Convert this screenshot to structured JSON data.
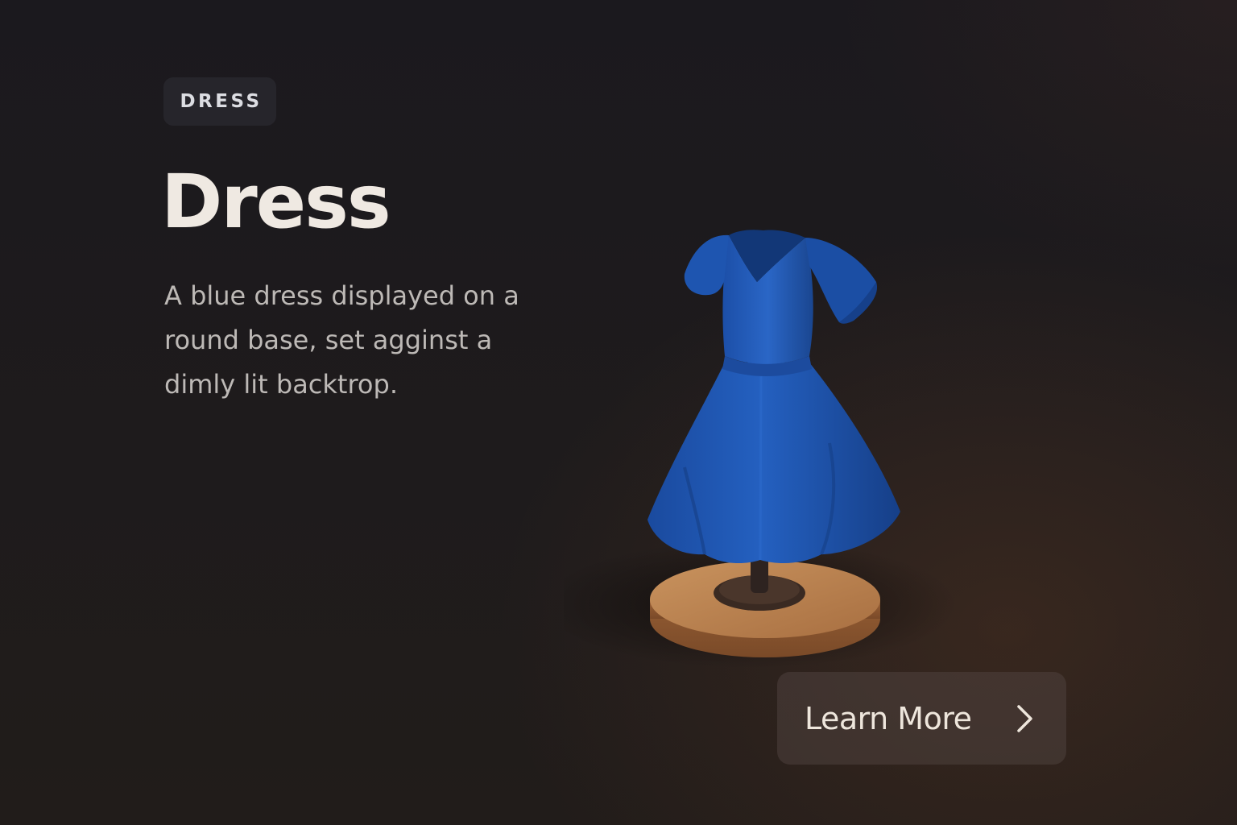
{
  "badge": {
    "label": "DRESS"
  },
  "hero": {
    "title": "Dress",
    "description": "A blue dress displayed on a round base, set agginst a dimly lit backtrop."
  },
  "cta": {
    "label": "Learn More",
    "icon": "chevron-right-icon"
  },
  "illustration": {
    "subject": "dress-on-stand-icon"
  },
  "colors": {
    "dress": "#1f56b4",
    "base": "#b9814f",
    "title": "#efe9e2",
    "text": "#bdb9b6",
    "badge_bg": "#26252b",
    "button_bg": "#3e3532"
  }
}
